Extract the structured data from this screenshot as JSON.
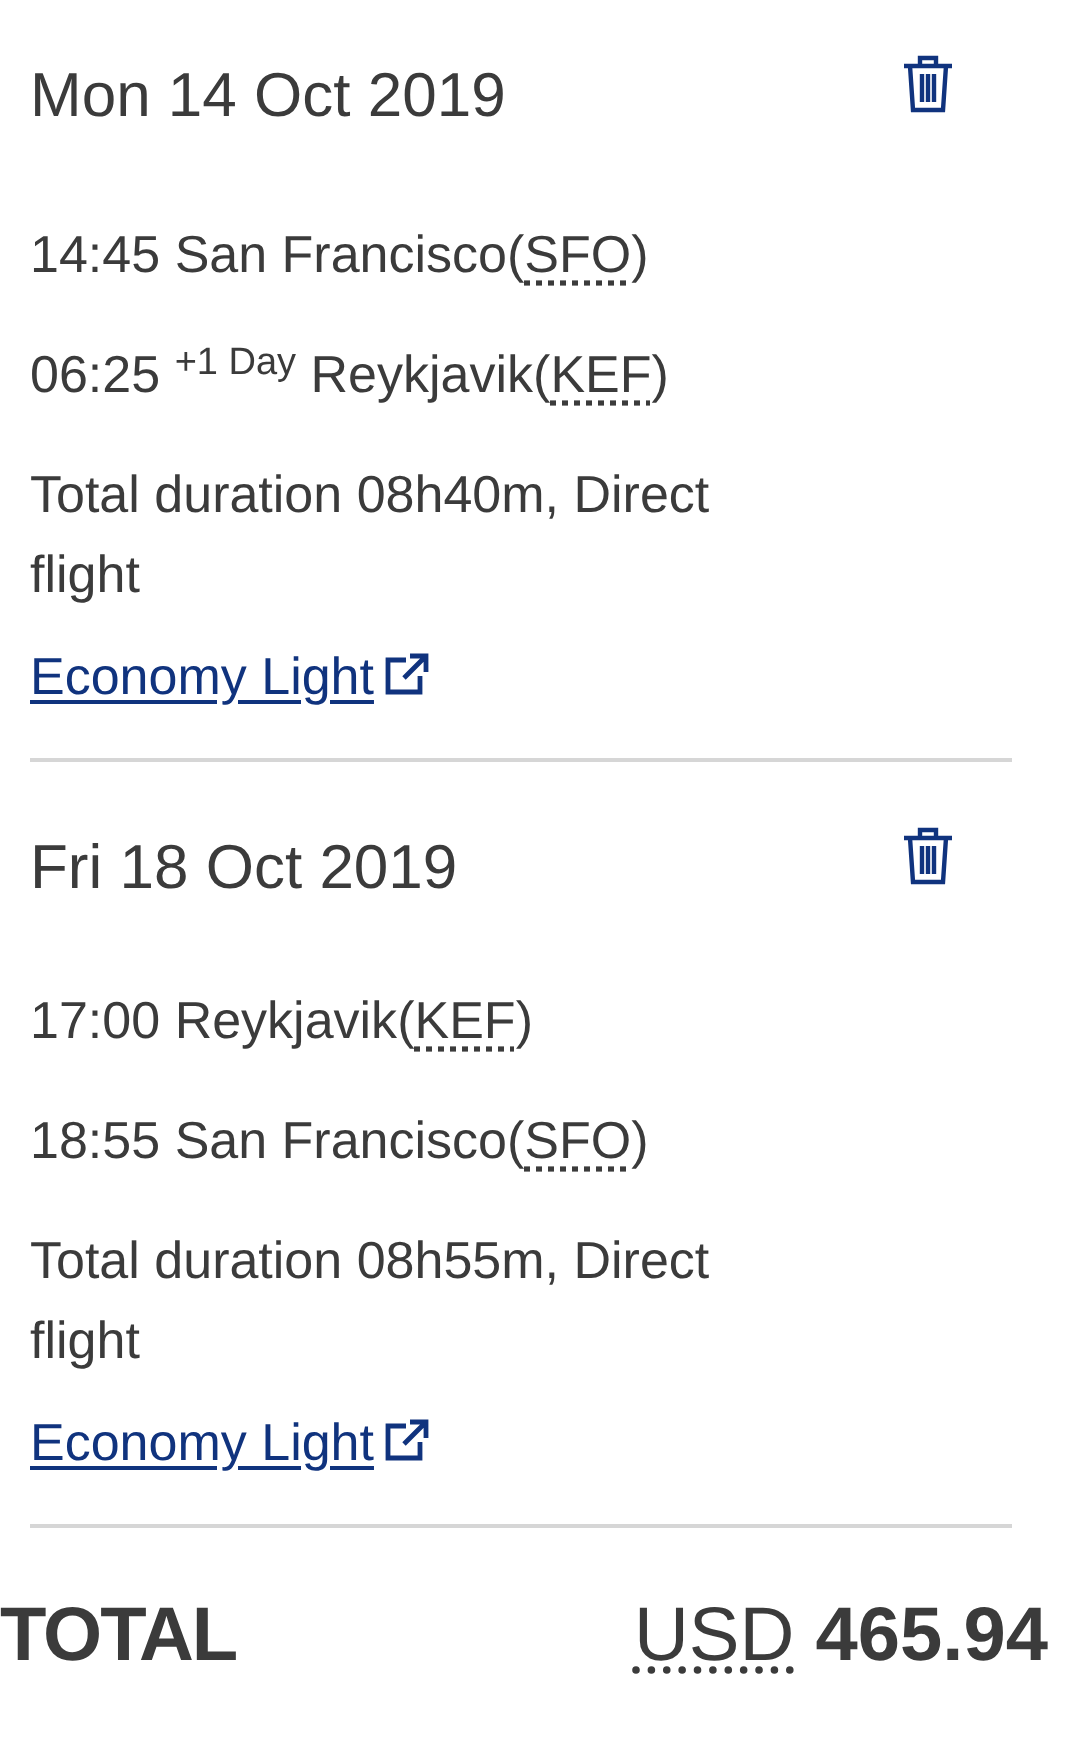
{
  "flights": [
    {
      "date": "Mon 14 Oct 2019",
      "departure": {
        "time": "14:45",
        "city": "San Francisco",
        "open": "(",
        "code": "SFO",
        "close": ")"
      },
      "arrival": {
        "time": "06:25",
        "day_offset": "+1 Day",
        "city": "Reykjavik",
        "open": "(",
        "code": "KEF",
        "close": ")"
      },
      "duration": "Total duration 08h40m, Direct flight",
      "fare_link": "Economy Light"
    },
    {
      "date": "Fri 18 Oct 2019",
      "departure": {
        "time": "17:00",
        "city": "Reykjavik",
        "open": "(",
        "code": "KEF",
        "close": ")"
      },
      "arrival": {
        "time": "18:55",
        "city": "San Francisco",
        "open": "(",
        "code": "SFO",
        "close": ")"
      },
      "duration": "Total duration 08h55m, Direct flight",
      "fare_link": "Economy Light"
    }
  ],
  "total": {
    "label": "TOTAL",
    "currency": "USD",
    "amount": "465.94"
  }
}
